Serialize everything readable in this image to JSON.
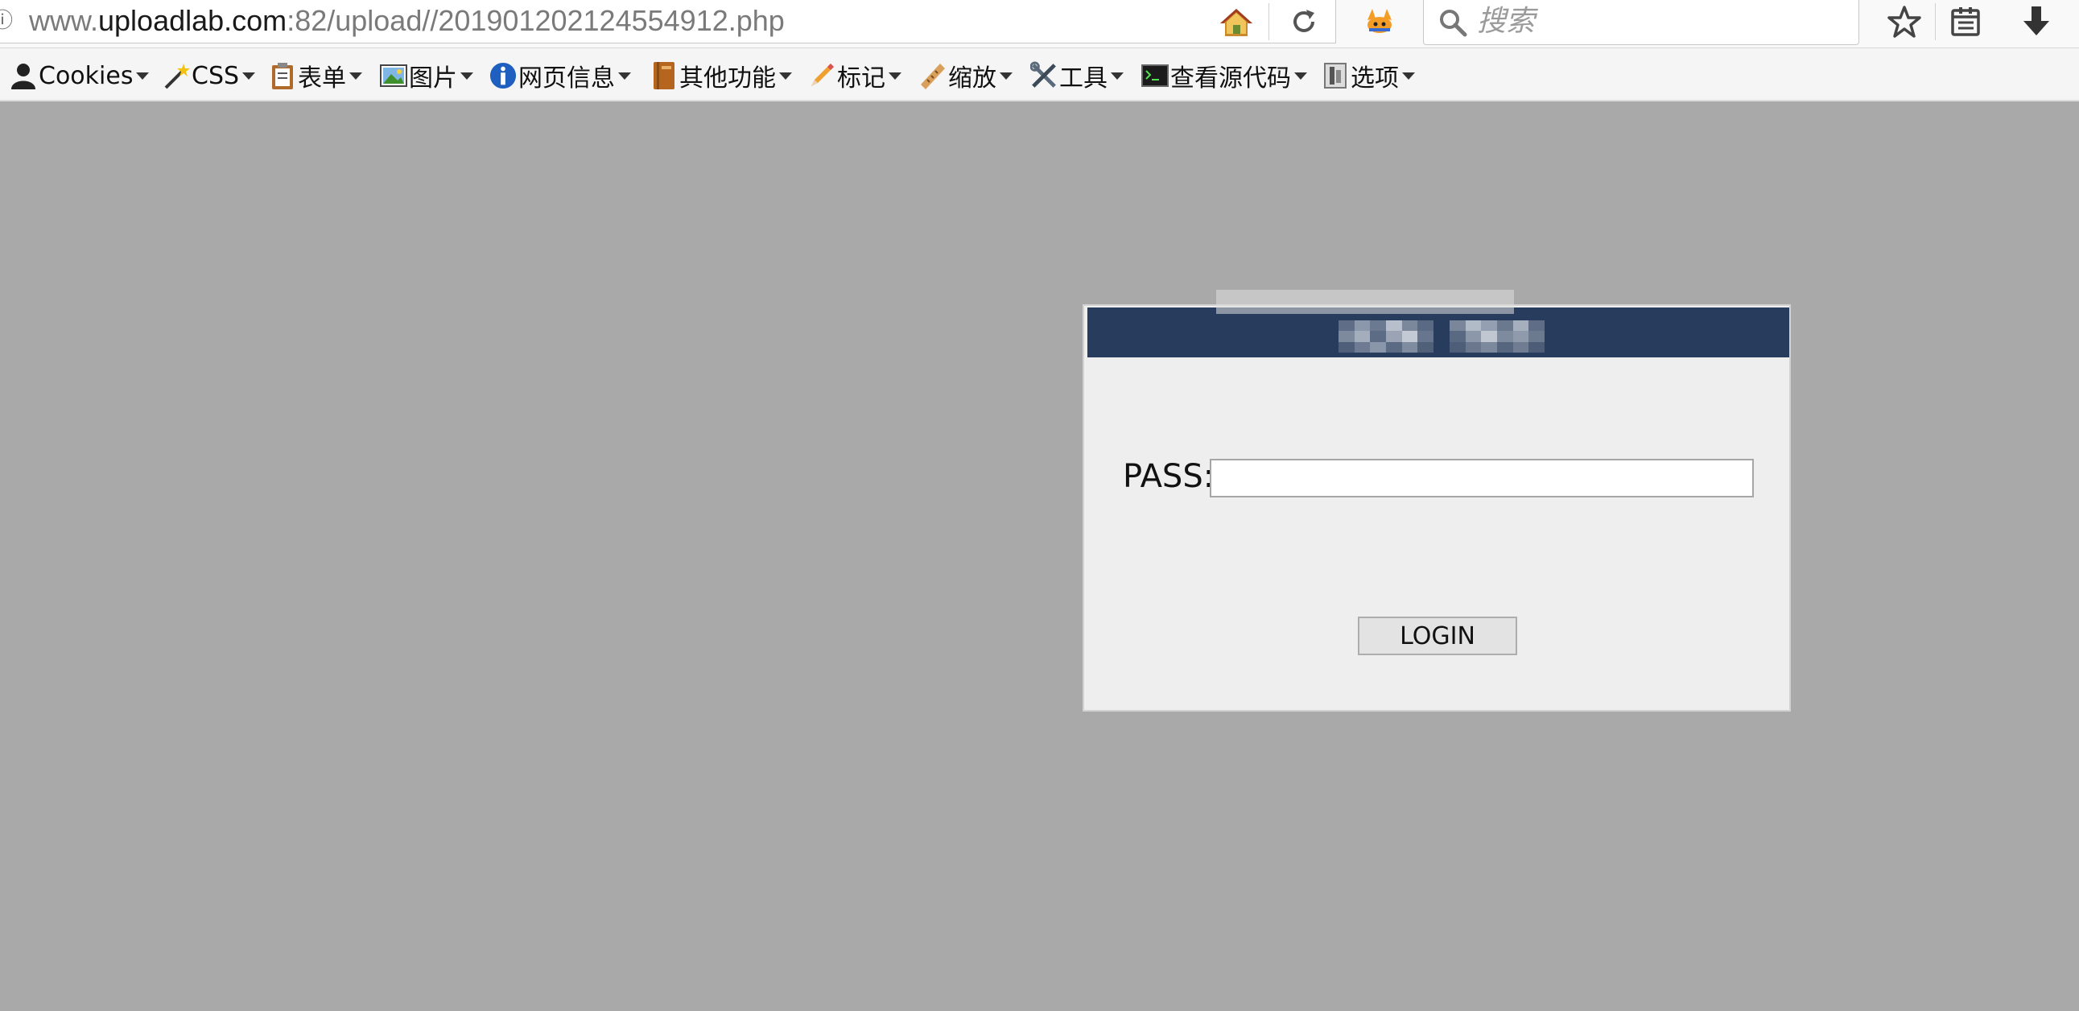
{
  "address_bar": {
    "url_prefix": "www.",
    "url_host": "uploadlab.com",
    "url_rest": ":82/upload//201901202124554912.php"
  },
  "search": {
    "placeholder": "搜索"
  },
  "navbar_icons": [
    "home-icon",
    "reload-icon",
    "extension-icon",
    "bookmark-star-icon",
    "reading-list-icon",
    "download-icon"
  ],
  "dev_toolbar": {
    "items": [
      {
        "label": "Cookies",
        "icon": "cookie-person-icon"
      },
      {
        "label": "CSS",
        "icon": "magic-wand-icon"
      },
      {
        "label": "表单",
        "icon": "clipboard-icon"
      },
      {
        "label": "图片",
        "icon": "image-icon"
      },
      {
        "label": "网页信息",
        "icon": "info-icon"
      },
      {
        "label": "其他功能",
        "icon": "book-icon"
      },
      {
        "label": "标记",
        "icon": "pencil-icon"
      },
      {
        "label": "缩放",
        "icon": "ruler-icon"
      },
      {
        "label": "工具",
        "icon": "tools-icon"
      },
      {
        "label": "查看源代码",
        "icon": "terminal-icon"
      },
      {
        "label": "选项",
        "icon": "options-icon"
      }
    ]
  },
  "login": {
    "pass_label": "PASS:",
    "pass_value": "",
    "button_label": "LOGIN"
  },
  "colors": {
    "page_background": "#a9a9a9",
    "panel_background": "#eeeeee",
    "panel_header": "#283c5e"
  }
}
